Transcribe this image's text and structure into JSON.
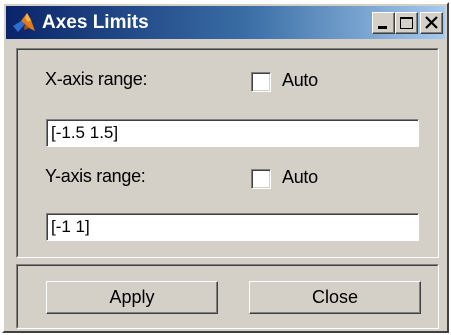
{
  "window": {
    "title": "Axes Limits",
    "controls": [
      "minimize-icon",
      "maximize-icon",
      "close-icon"
    ]
  },
  "x_axis": {
    "label": "X-axis range:",
    "auto_label": "Auto",
    "auto_checked": false,
    "value": "[-1.5 1.5]"
  },
  "y_axis": {
    "label": "Y-axis range:",
    "auto_label": "Auto",
    "auto_checked": false,
    "value": "[-1 1]"
  },
  "buttons": {
    "apply": "Apply",
    "close": "Close"
  }
}
